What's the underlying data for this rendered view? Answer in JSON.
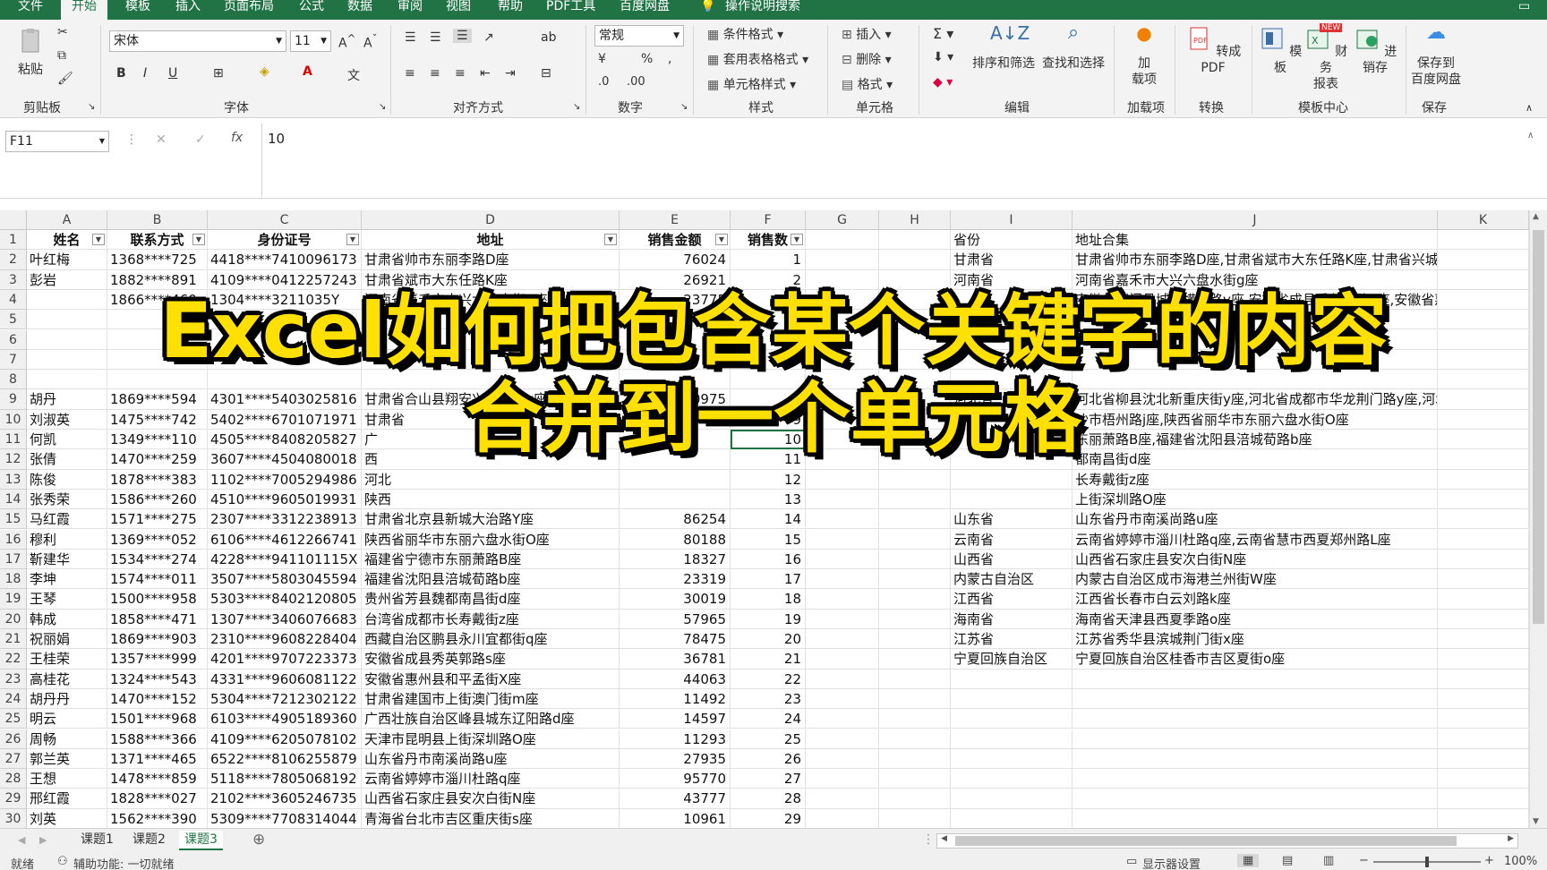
{
  "menu": {
    "tabs": [
      "文件",
      "开始",
      "模板",
      "插入",
      "页面布局",
      "公式",
      "数据",
      "审阅",
      "视图",
      "帮助",
      "PDF工具",
      "百度网盘"
    ],
    "search": "操作说明搜索"
  },
  "ribbon": {
    "paste": "粘贴",
    "font_name": "宋体",
    "font_size": "11",
    "number_format": "常规",
    "groups": {
      "clipboard": "剪贴板",
      "font": "字体",
      "align": "对齐方式",
      "number": "数字",
      "style": "样式",
      "cells": "单元格",
      "edit": "编辑",
      "addin": "加载项",
      "convert": "转换",
      "tplcenter": "模板中心",
      "save": "保存"
    },
    "style_btns": [
      "条件格式",
      "套用表格格式",
      "单元格样式"
    ],
    "cell_btns": [
      "插入",
      "删除",
      "格式"
    ],
    "edit_btns": [
      "排序和筛选",
      "查找和选择"
    ],
    "addin_btn": [
      "加",
      "载项"
    ],
    "pdf_btn": "转成PDF",
    "tpl_btns": [
      "模板",
      "财务",
      "报表",
      "进销存"
    ],
    "save_btn": [
      "保存到",
      "百度网盘"
    ],
    "new_badge": "NEW"
  },
  "formula_bar": {
    "name_box": "F11",
    "fx": "fx",
    "value": "10"
  },
  "columns": [
    "A",
    "B",
    "C",
    "D",
    "E",
    "F",
    "G",
    "H",
    "I",
    "J",
    "K"
  ],
  "header_row": [
    "姓名",
    "联系方式",
    "身份证号",
    "地址",
    "销售金额",
    "销售数"
  ],
  "rows": [
    [
      "叶红梅",
      "1368****725",
      "4418****7410096173",
      "甘肃省帅市东丽李路D座",
      "76024",
      "1"
    ],
    [
      "彭岩",
      "1882****891",
      "4109****0412257243",
      "甘肃省斌市大东任路K座",
      "26921",
      "2"
    ],
    [
      "",
      "1866****460",
      "1304****3211035Y",
      "河南省嘉禾市大兴六盘水街g座",
      "23775",
      ""
    ],
    [
      "",
      "",
      "",
      "",
      "",
      ""
    ],
    [
      "",
      "",
      "",
      "",
      "",
      ""
    ],
    [
      "",
      "",
      "",
      "",
      "",
      ""
    ],
    [
      "",
      "",
      "",
      "",
      "",
      ""
    ],
    [
      "胡丹",
      "1869****594",
      "4301****5403025816",
      "甘肃省合山县翔安兴安盟街y座",
      "70975",
      "8"
    ],
    [
      "刘淑英",
      "1475****742",
      "5402****6701071971",
      "甘肃省",
      "",
      "9"
    ],
    [
      "何凯",
      "1349****110",
      "4505****8408205827",
      "广",
      "",
      "10"
    ],
    [
      "张倩",
      "1470****259",
      "3607****4504080018",
      "西",
      "",
      "11"
    ],
    [
      "陈俊",
      "1878****383",
      "1102****7005294986",
      "河北",
      "",
      "12"
    ],
    [
      "张秀荣",
      "1586****260",
      "4510****9605019931",
      "陕西",
      "",
      "13"
    ],
    [
      "马红霞",
      "1571****275",
      "2307****3312238913",
      "甘肃省北京县新城大治路Y座",
      "86254",
      "14"
    ],
    [
      "穆利",
      "1369****052",
      "6106****4612266741",
      "陕西省丽华市东丽六盘水街O座",
      "80188",
      "15"
    ],
    [
      "靳建华",
      "1534****274",
      "4228****941101115X",
      "福建省宁德市东丽萧路B座",
      "18327",
      "16"
    ],
    [
      "李坤",
      "1574****011",
      "3507****5803045594",
      "福建省沈阳县涪城荀路b座",
      "23319",
      "17"
    ],
    [
      "王琴",
      "1500****958",
      "5303****8402120805",
      "贵州省芳县魏都南昌街d座",
      "30019",
      "18"
    ],
    [
      "韩成",
      "1858****471",
      "1307****3406076683",
      "台湾省成都市长寿戴街z座",
      "57965",
      "19"
    ],
    [
      "祝丽娟",
      "1869****903",
      "2310****9608228404",
      "西藏自治区鹏县永川宜都街q座",
      "78475",
      "20"
    ],
    [
      "王桂荣",
      "1357****999",
      "4201****9707223373",
      "安徽省成县秀英郭路s座",
      "36781",
      "21"
    ],
    [
      "高桂花",
      "1324****543",
      "4331****9606081122",
      "安徽省惠州县和平孟街X座",
      "44063",
      "22"
    ],
    [
      "胡丹丹",
      "1470****152",
      "5304****7212302122",
      "甘肃省建国市上街澳门街m座",
      "11492",
      "23"
    ],
    [
      "明云",
      "1501****968",
      "6103****4905189360",
      "广西壮族自治区峰县城东辽阳路d座",
      "14597",
      "24"
    ],
    [
      "周畅",
      "1588****366",
      "4109****6205078102",
      "天津市昆明县上街深圳路O座",
      "11293",
      "25"
    ],
    [
      "郭兰英",
      "1371****465",
      "6522****8106255879",
      "山东省丹市南溪尚路u座",
      "27935",
      "26"
    ],
    [
      "王想",
      "1478****859",
      "5118****7805068192",
      "云南省婷婷市淄川杜路q座",
      "95770",
      "27"
    ],
    [
      "邢红霞",
      "1828****027",
      "2102****3605246735",
      "山西省石家庄县安次白街N座",
      "43777",
      "28"
    ],
    [
      "刘英",
      "1562****390",
      "5309****7708314044",
      "青海省台北市吉区重庆街s座",
      "10961",
      "29"
    ]
  ],
  "right_header": [
    "省份",
    "地址合集"
  ],
  "right_rows": [
    [
      "甘肃省",
      "甘肃省帅市东丽李路D座,甘肃省斌市大东任路K座,甘肃省兴城县高"
    ],
    [
      "河南省",
      "河南省嘉禾市大兴六盘水街g座"
    ],
    [
      "",
      "安徽省荆门县城北横山路v座,安徽省成县秀英郭路s座,安徽省惠州"
    ],
    [
      "",
      ""
    ],
    [
      "",
      "云杨"
    ],
    [
      "",
      ""
    ],
    [
      "",
      ""
    ],
    [
      "河北省",
      "河北省柳县沈北新重庆街y座,河北省成都市华龙荆门路y座,河北省"
    ],
    [
      "",
      "沙市梧州路j座,陕西省丽华市东丽六盘水街O座"
    ],
    [
      "",
      "东丽萧路B座,福建省沈阳县涪城荀路b座"
    ],
    [
      "",
      "都南昌街d座"
    ],
    [
      "",
      "长寿戴街z座"
    ],
    [
      "",
      "上街深圳路O座"
    ],
    [
      "山东省",
      "山东省丹市南溪尚路u座"
    ],
    [
      "云南省",
      "云南省婷婷市淄川杜路q座,云南省慧市西夏郑州路L座"
    ],
    [
      "山西省",
      "山西省石家庄县安次白街N座"
    ],
    [
      "内蒙古自治区",
      "内蒙古自治区成市海港兰州街W座"
    ],
    [
      "江西省",
      "江西省长春市白云刘路k座"
    ],
    [
      "海南省",
      "海南省天津县西夏季路o座"
    ],
    [
      "江苏省",
      "江苏省秀华县滨城荆门街x座"
    ],
    [
      "宁夏回族自治区",
      "宁夏回族自治区桂香市吉区夏街o座"
    ]
  ],
  "sheets": [
    "课题1",
    "课题2",
    "课题3"
  ],
  "active_sheet": "课题3",
  "status": {
    "ready": "就绪",
    "accessibility": "辅助功能: 一切就绪",
    "display": "显示器设置",
    "zoom": "100%"
  },
  "overlay": {
    "line1": "Excel如何把包含某个关键字的内容",
    "line2": "合并到一个单元格"
  },
  "colors": {
    "excel_green": "#217346",
    "overlay_text": "#ffe000"
  }
}
